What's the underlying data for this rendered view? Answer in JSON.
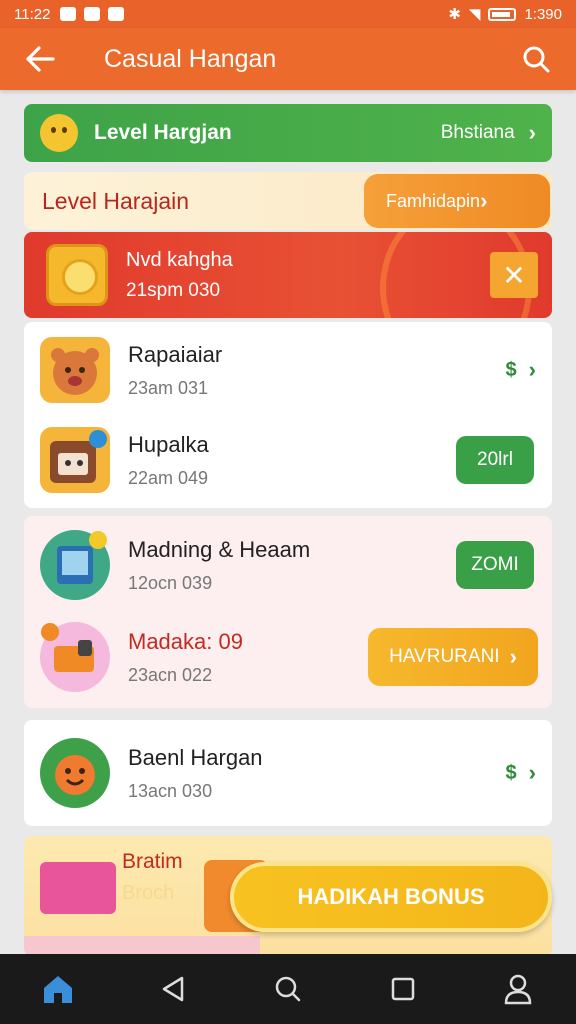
{
  "status": {
    "time": "11:22",
    "right": "1:390"
  },
  "appbar": {
    "title": "Casual Hangan"
  },
  "level_green": {
    "label": "Level Hargjan",
    "side": "Bhstiana"
  },
  "level_cream": {
    "label": "Level Harajain",
    "button": "Famhidapin"
  },
  "banner": {
    "title": "Nvd kahgha",
    "subtitle": "21spm 030"
  },
  "list1": [
    {
      "name": "Rapaiaiar",
      "time": "23am 031"
    },
    {
      "name": "Hupalka",
      "time": "22am 049",
      "button": "20lrl"
    }
  ],
  "list2": [
    {
      "name": "Madning & Heaam",
      "time": "12ocn 039",
      "button": "ZOMI"
    },
    {
      "name": "Madaka: 09",
      "time": "23acn 022",
      "button": "HAVRURANI"
    }
  ],
  "list3": {
    "name": "Baenl Hargan",
    "time": "13acn 030"
  },
  "bonus": {
    "title": "Bratim",
    "subtitle": "Broch",
    "button": "HADIKAH BONUS"
  },
  "colors": {
    "accent": "#ec6a2c",
    "green": "#3ea348",
    "red": "#e03a2d",
    "yellow": "#f6b82d"
  }
}
